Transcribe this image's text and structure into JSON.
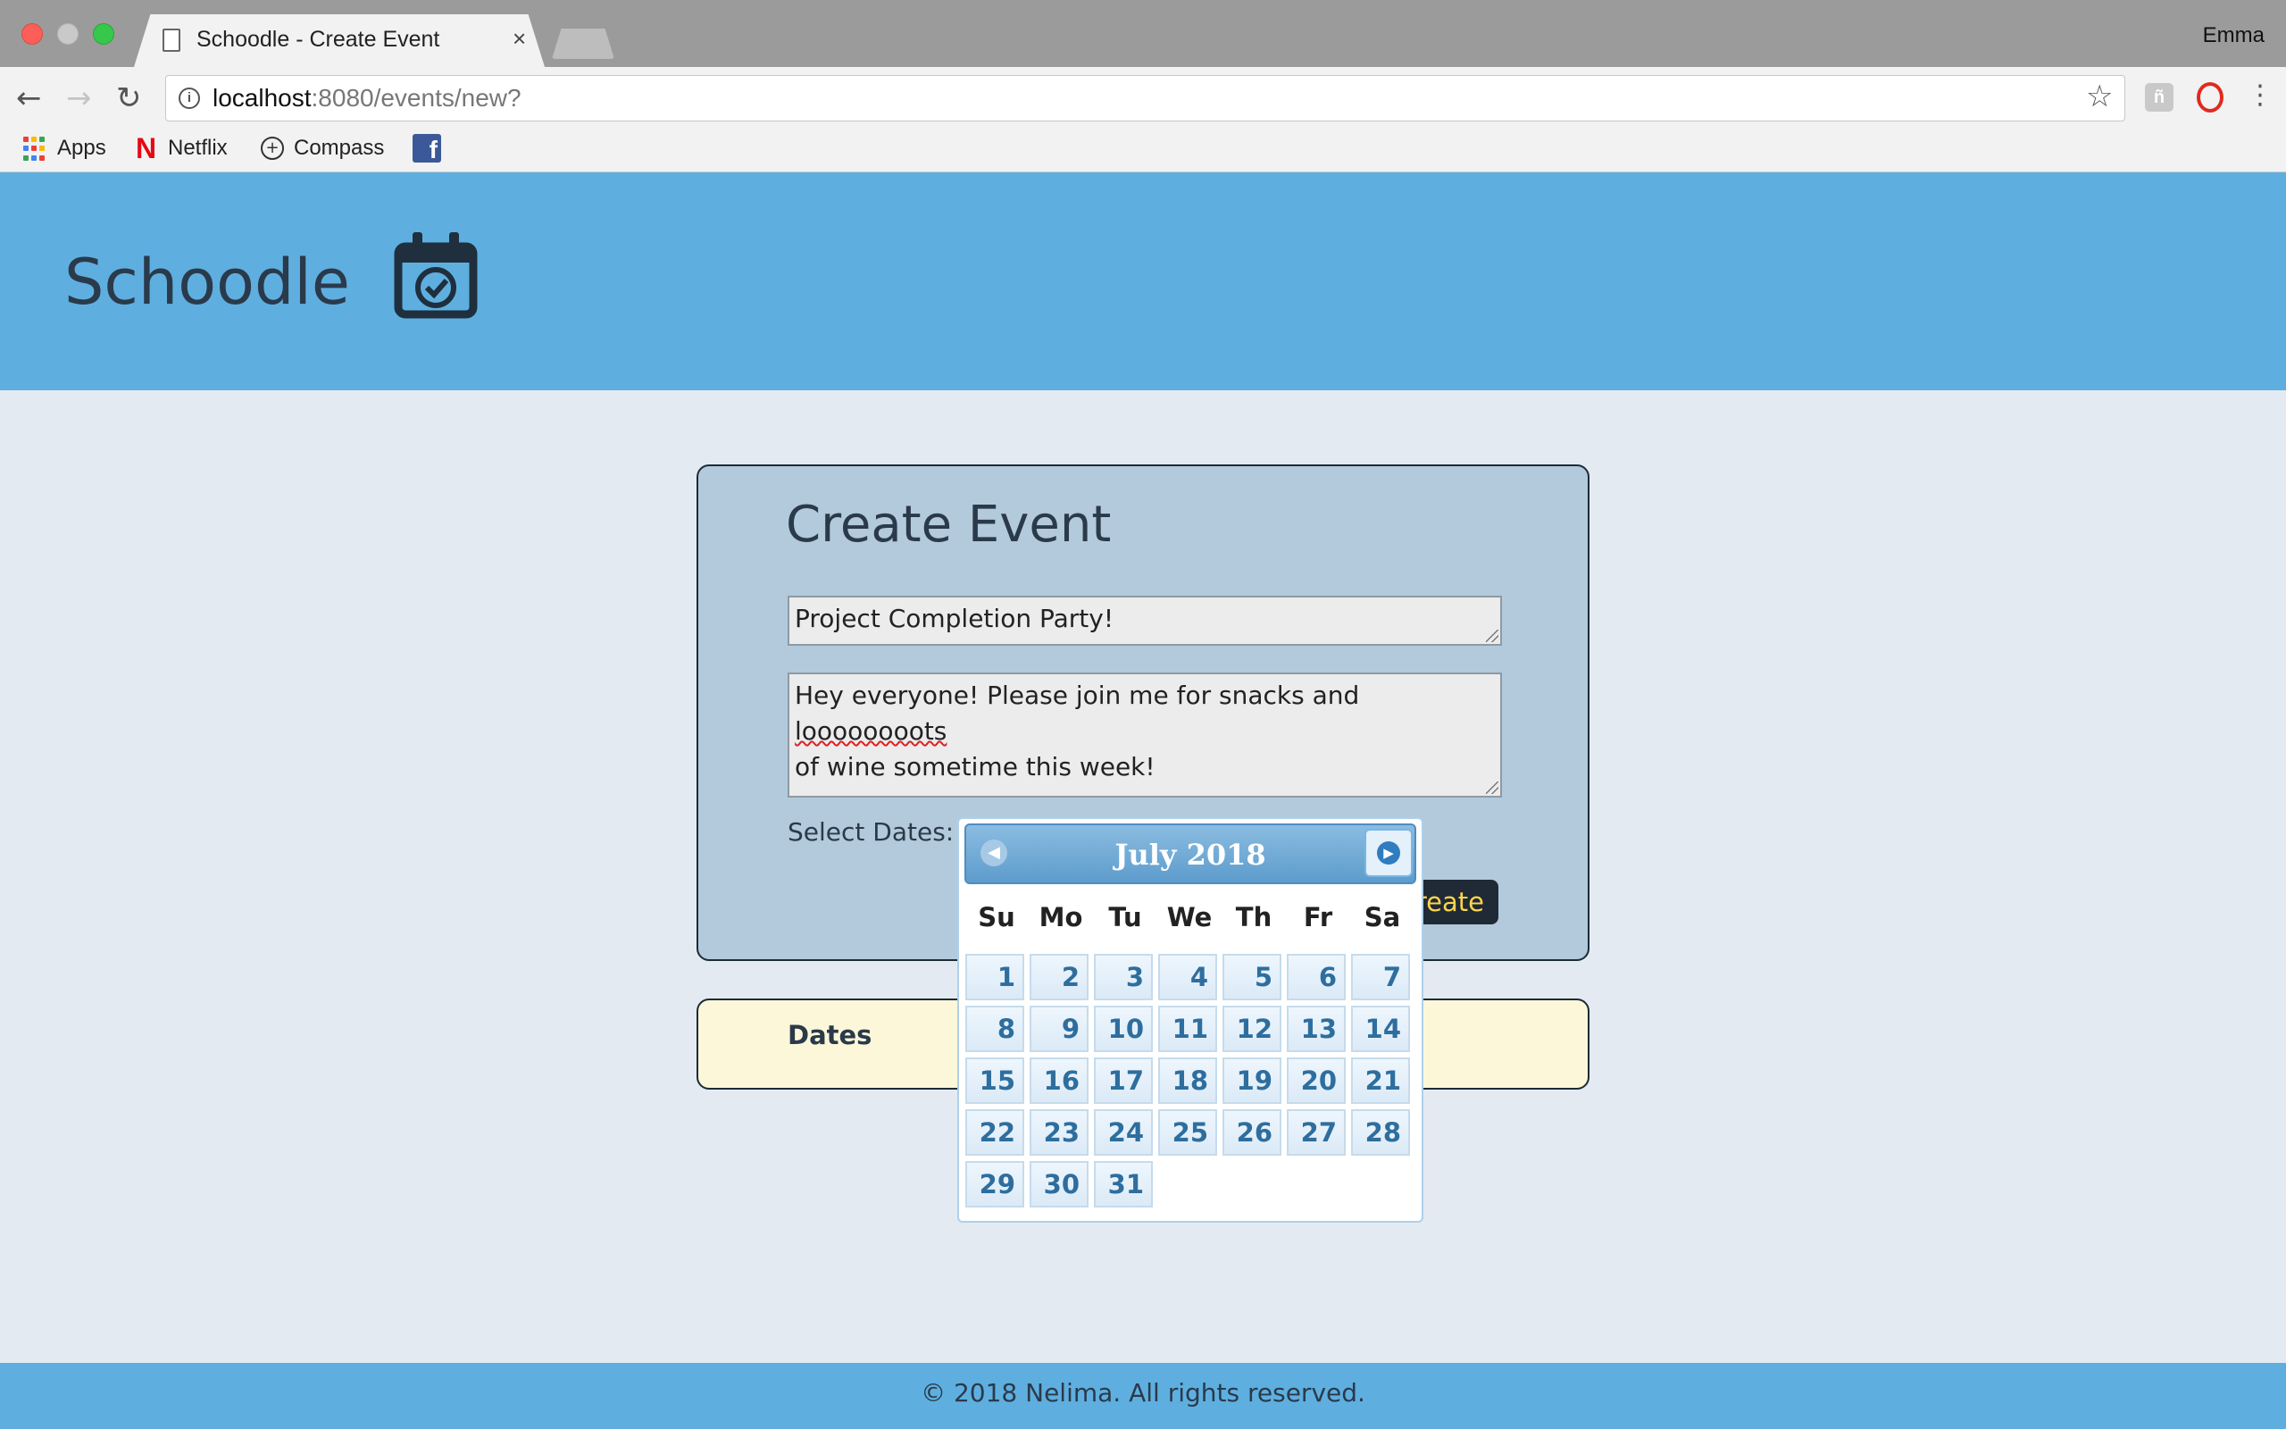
{
  "browser": {
    "tab_title": "Schoodle - Create Event",
    "tab_close": "×",
    "user_name": "Emma",
    "url_host": "localhost",
    "url_path": ":8080/events/new?",
    "bookmarks": {
      "apps": "Apps",
      "netflix": "Netflix",
      "compass": "Compass"
    }
  },
  "site": {
    "logo_text": "Schoodle",
    "footer": "© 2018 Nelima. All rights reserved."
  },
  "form": {
    "heading": "Create Event",
    "title_value": "Project Completion Party!",
    "description_before": "Hey everyone! Please join me for snacks and ",
    "description_misspelled": "loooooooots",
    "description_line2": "of wine sometime this week!",
    "select_dates_label": "Select Dates:",
    "create_button": "reate"
  },
  "dates_panel": {
    "heading": "Dates"
  },
  "datepicker": {
    "month_label": "July 2018",
    "weekdays": [
      "Su",
      "Mo",
      "Tu",
      "We",
      "Th",
      "Fr",
      "Sa"
    ],
    "days": [
      "1",
      "2",
      "3",
      "4",
      "5",
      "6",
      "7",
      "8",
      "9",
      "10",
      "11",
      "12",
      "13",
      "14",
      "15",
      "16",
      "17",
      "18",
      "19",
      "20",
      "21",
      "22",
      "23",
      "24",
      "25",
      "26",
      "27",
      "28",
      "29",
      "30",
      "31"
    ]
  },
  "colors": {
    "header_blue": "#5eafe0",
    "page_bg": "#e3eaf2",
    "card_bg": "#b2cadb",
    "dates_bg": "#fdf7d9",
    "button_bg": "#1f2a36",
    "button_text": "#ffd54a"
  }
}
